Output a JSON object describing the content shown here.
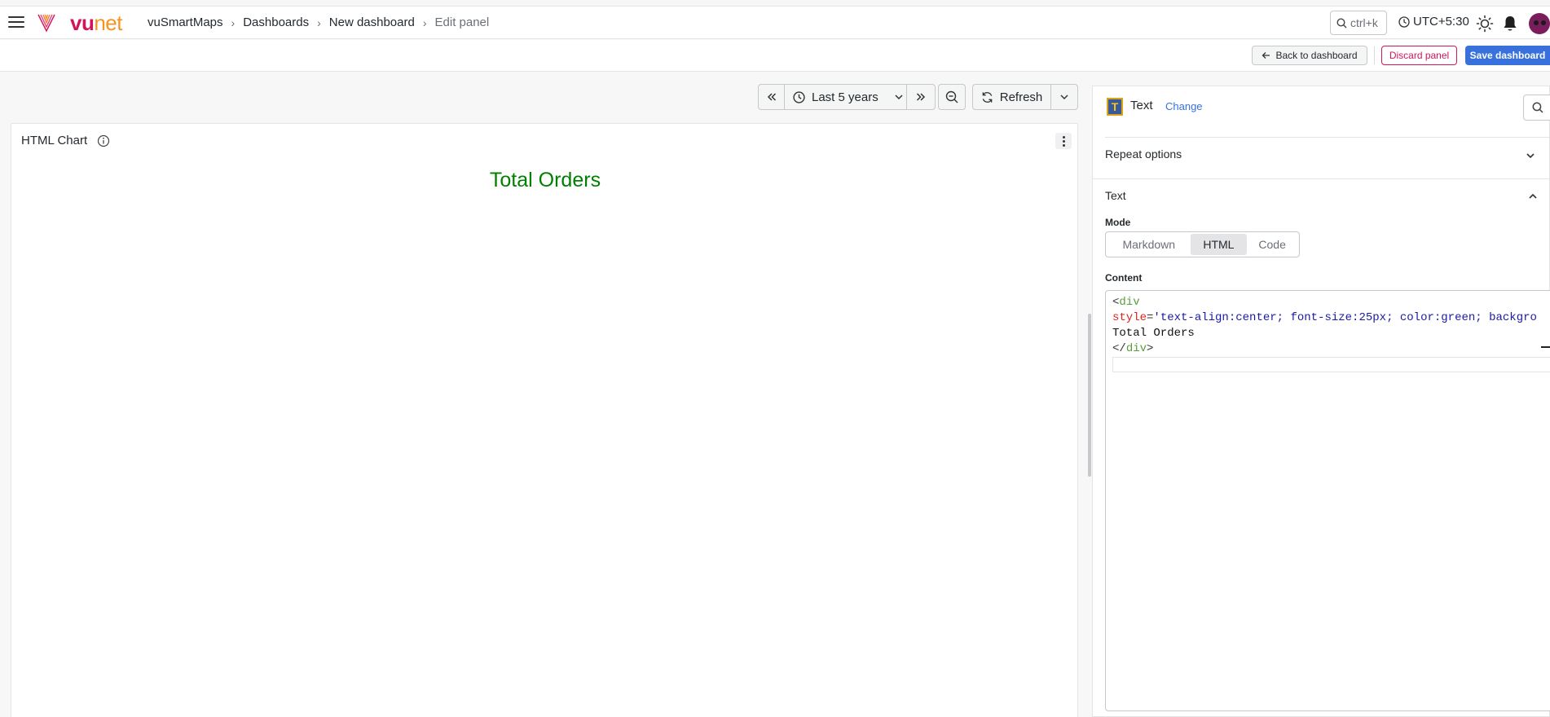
{
  "brand": {
    "vu": "vu",
    "net": "net"
  },
  "breadcrumb": [
    "vuSmartMaps",
    "Dashboards",
    "New dashboard",
    "Edit panel"
  ],
  "search": {
    "shortcut": "ctrl+k"
  },
  "timezone": "UTC+5:30",
  "actions": {
    "back": "Back to dashboard",
    "discard": "Discard panel",
    "save": "Save dashboard"
  },
  "toolbar": {
    "time_range": "Last 5 years",
    "refresh": "Refresh"
  },
  "panel": {
    "title": "HTML Chart",
    "rendered_text": "Total Orders"
  },
  "options": {
    "visualization": "Text",
    "change": "Change",
    "repeat_options": "Repeat options",
    "text_section": "Text",
    "mode_label": "Mode",
    "modes": [
      "Markdown",
      "HTML",
      "Code"
    ],
    "mode_selected": "HTML",
    "content_label": "Content",
    "content": {
      "line1_open": "<",
      "line1_tag": "div",
      "line2_attr": "style",
      "line2_eq": "=",
      "line2_value": "'text-align:center; font-size:25px; color:green; backgro",
      "line3": "Total Orders",
      "line4_open": "</",
      "line4_tag": "div",
      "line4_close": ">"
    }
  },
  "colors": {
    "brand_pink": "#d4145a",
    "brand_orange": "#f7931e",
    "primary": "#3871dc",
    "panel_text": "green"
  },
  "icons": [
    "menu-icon",
    "search-icon",
    "clock-icon",
    "sun-icon",
    "bell-icon",
    "arrow-left-icon",
    "chevrons-left-icon",
    "chevrons-right-icon",
    "zoom-out-icon",
    "refresh-icon",
    "chevron-down-icon",
    "chevron-up-icon",
    "info-icon",
    "more-vertical-icon"
  ]
}
